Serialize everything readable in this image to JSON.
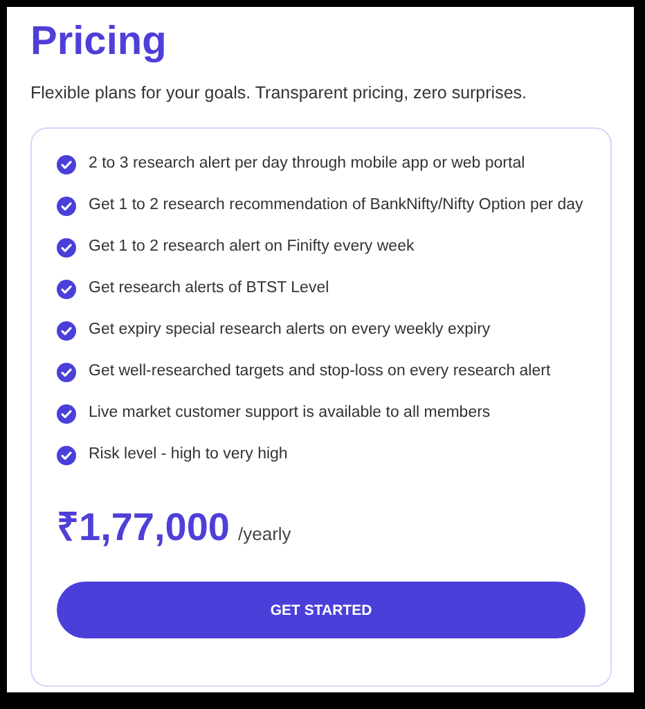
{
  "title": "Pricing",
  "subtitle": "Flexible plans for your goals. Transparent pricing, zero surprises.",
  "features": [
    {
      "text": "2 to 3 research alert per day through mobile app or web portal"
    },
    {
      "text": "Get 1 to 2 research recommendation of BankNifty/Nifty Option per day"
    },
    {
      "text": "Get 1 to 2 research alert on Finifty every week"
    },
    {
      "text": "Get research alerts of BTST Level"
    },
    {
      "text": "Get expiry special research alerts on every weekly expiry"
    },
    {
      "text": "Get well-researched targets and stop-loss on every research alert"
    },
    {
      "text": "Live market customer support is available to all members"
    },
    {
      "text": "Risk level - high to very high"
    }
  ],
  "price": "₹1,77,000",
  "period": "/yearly",
  "button": "GET STARTED"
}
